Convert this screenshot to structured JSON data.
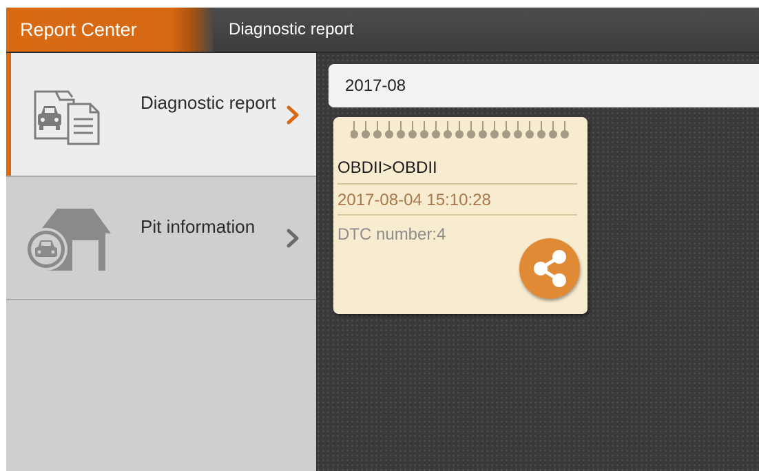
{
  "header": {
    "app_title": "Report Center",
    "page_title": "Diagnostic report"
  },
  "sidebar": {
    "items": [
      {
        "label": "Diagnostic report",
        "icon": "car-report-folder-icon",
        "selected": true
      },
      {
        "label": "Pit information",
        "icon": "car-garage-icon",
        "selected": false
      }
    ]
  },
  "content": {
    "month": "2017-08",
    "reports": [
      {
        "title": "OBDII>OBDII",
        "datetime": "2017-08-04 15:10:28",
        "dtc": "DTC number:4",
        "action_icon": "share-icon"
      }
    ]
  },
  "colors": {
    "accent": "#d86a14",
    "card_bg": "#f7ebd0",
    "date_text": "#a9774a",
    "share_button": "#e08a36"
  }
}
